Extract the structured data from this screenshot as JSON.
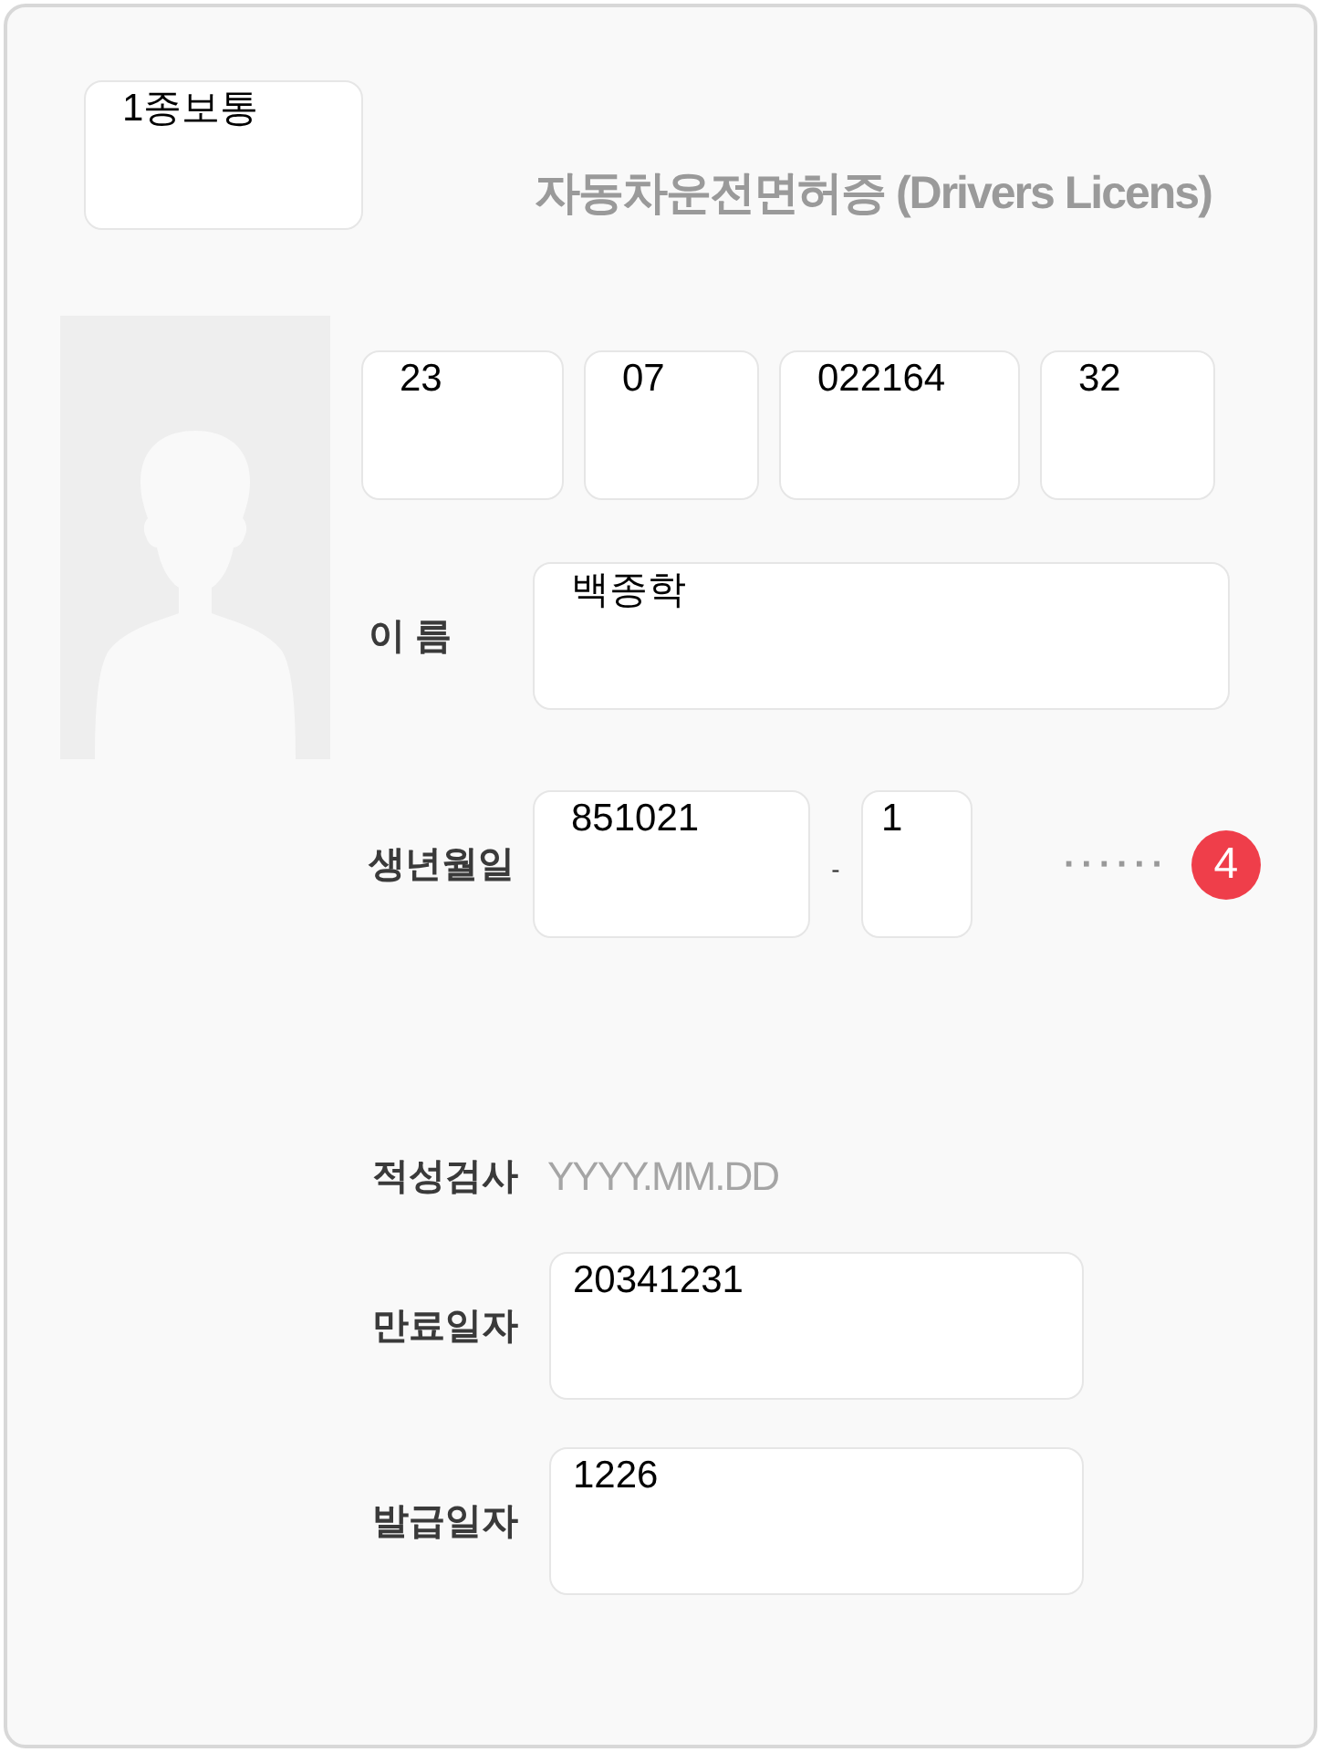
{
  "license_type": {
    "value": "1종보통"
  },
  "title": "자동차운전면허증 (Drivers Licens)",
  "license_number": [
    {
      "value": "23"
    },
    {
      "value": "07"
    },
    {
      "value": "022164"
    },
    {
      "value": "32"
    }
  ],
  "name": {
    "label": "이 름",
    "value": "백종학"
  },
  "birth": {
    "label": "생년월일",
    "front": "851021",
    "separator": "-",
    "back_first": "1",
    "back_masked": "······",
    "badge": "4"
  },
  "aptitude": {
    "label": "적성검사",
    "placeholder": "YYYY.MM.DD"
  },
  "expiry": {
    "label": "만료일자",
    "value": "20341231"
  },
  "issue": {
    "label": "발급일자",
    "value": "1226"
  }
}
